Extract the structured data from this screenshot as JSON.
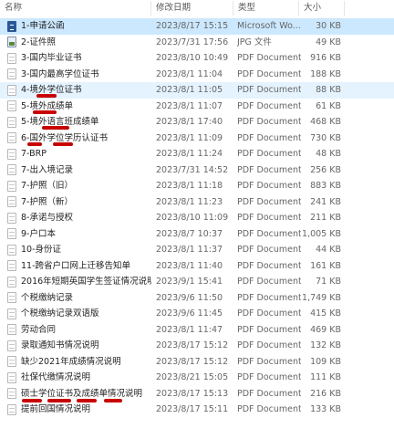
{
  "header": {
    "name": "名称",
    "date": "修改日期",
    "type": "类型",
    "size": "大小"
  },
  "files": [
    {
      "name": "1-申请公函",
      "date": "2023/8/17 15:15",
      "type": "Microsoft Wo...",
      "size": "30 KB",
      "icon": "word-document-icon"
    },
    {
      "name": "2-证件照",
      "date": "2023/7/31 17:56",
      "type": "JPG 文件",
      "size": "49 KB",
      "icon": "jpg-file-icon"
    },
    {
      "name": "3-国内毕业证书",
      "date": "2023/8/10 10:49",
      "type": "PDF Document",
      "size": "916 KB",
      "icon": "pdf-file-icon"
    },
    {
      "name": "3-国内最高学位证书",
      "date": "2023/8/1 11:04",
      "type": "PDF Document",
      "size": "188 KB",
      "icon": "pdf-file-icon"
    },
    {
      "name": "4-境外学位证书",
      "date": "2023/8/1 11:05",
      "type": "PDF Document",
      "size": "88 KB",
      "icon": "pdf-file-icon"
    },
    {
      "name": "5-境外成绩单",
      "date": "2023/8/1 11:07",
      "type": "PDF Document",
      "size": "61 KB",
      "icon": "pdf-file-icon"
    },
    {
      "name": "5-境外语言班成绩单",
      "date": "2023/8/1 17:40",
      "type": "PDF Document",
      "size": "468 KB",
      "icon": "pdf-file-icon"
    },
    {
      "name": "6-国外学位学历认证书",
      "date": "2023/8/1 11:09",
      "type": "PDF Document",
      "size": "730 KB",
      "icon": "pdf-file-icon"
    },
    {
      "name": "7-BRP",
      "date": "2023/8/1 11:24",
      "type": "PDF Document",
      "size": "48 KB",
      "icon": "pdf-file-icon"
    },
    {
      "name": "7-出入境记录",
      "date": "2023/7/31 14:52",
      "type": "PDF Document",
      "size": "256 KB",
      "icon": "pdf-file-icon"
    },
    {
      "name": "7-护照（旧）",
      "date": "2023/8/1 11:18",
      "type": "PDF Document",
      "size": "883 KB",
      "icon": "pdf-file-icon"
    },
    {
      "name": "7-护照（新）",
      "date": "2023/8/1 11:23",
      "type": "PDF Document",
      "size": "241 KB",
      "icon": "pdf-file-icon"
    },
    {
      "name": "8-承诺与授权",
      "date": "2023/8/10 11:09",
      "type": "PDF Document",
      "size": "211 KB",
      "icon": "pdf-file-icon"
    },
    {
      "name": "9-户口本",
      "date": "2023/8/7 10:37",
      "type": "PDF Document",
      "size": "1,005 KB",
      "icon": "pdf-file-icon"
    },
    {
      "name": "10-身份证",
      "date": "2023/8/1 11:37",
      "type": "PDF Document",
      "size": "44 KB",
      "icon": "pdf-file-icon"
    },
    {
      "name": "11-跨省户口网上迁移告知单",
      "date": "2023/8/1 11:40",
      "type": "PDF Document",
      "size": "161 KB",
      "icon": "pdf-file-icon"
    },
    {
      "name": "2016年短期英国学生签证情况说明",
      "date": "2023/9/1 15:41",
      "type": "PDF Document",
      "size": "71 KB",
      "icon": "pdf-file-icon"
    },
    {
      "name": "个税缴纳记录",
      "date": "2023/9/6 11:50",
      "type": "PDF Document",
      "size": "1,749 KB",
      "icon": "pdf-file-icon"
    },
    {
      "name": "个税缴纳记录双语版",
      "date": "2023/9/6 11:45",
      "type": "PDF Document",
      "size": "415 KB",
      "icon": "pdf-file-icon"
    },
    {
      "name": "劳动合同",
      "date": "2023/8/1 11:47",
      "type": "PDF Document",
      "size": "469 KB",
      "icon": "pdf-file-icon"
    },
    {
      "name": "录取通知书情况说明",
      "date": "2023/8/17 15:12",
      "type": "PDF Document",
      "size": "132 KB",
      "icon": "pdf-file-icon"
    },
    {
      "name": "缺少2021年成绩情况说明",
      "date": "2023/8/17 15:12",
      "type": "PDF Document",
      "size": "109 KB",
      "icon": "pdf-file-icon"
    },
    {
      "name": "社保代缴情况说明",
      "date": "2023/8/21 15:05",
      "type": "PDF Document",
      "size": "111 KB",
      "icon": "pdf-file-icon"
    },
    {
      "name": "硕士学位证书及成绩单情况说明",
      "date": "2023/8/17 15:13",
      "type": "PDF Document",
      "size": "216 KB",
      "icon": "pdf-file-icon"
    },
    {
      "name": "提前回国情况说明",
      "date": "2023/8/17 15:11",
      "type": "PDF Document",
      "size": "133 KB",
      "icon": "pdf-file-icon"
    }
  ],
  "colors": {
    "selected_row": "#cce8ff",
    "hover_row": "#e5f3ff",
    "annotation_red": "#c80000"
  }
}
